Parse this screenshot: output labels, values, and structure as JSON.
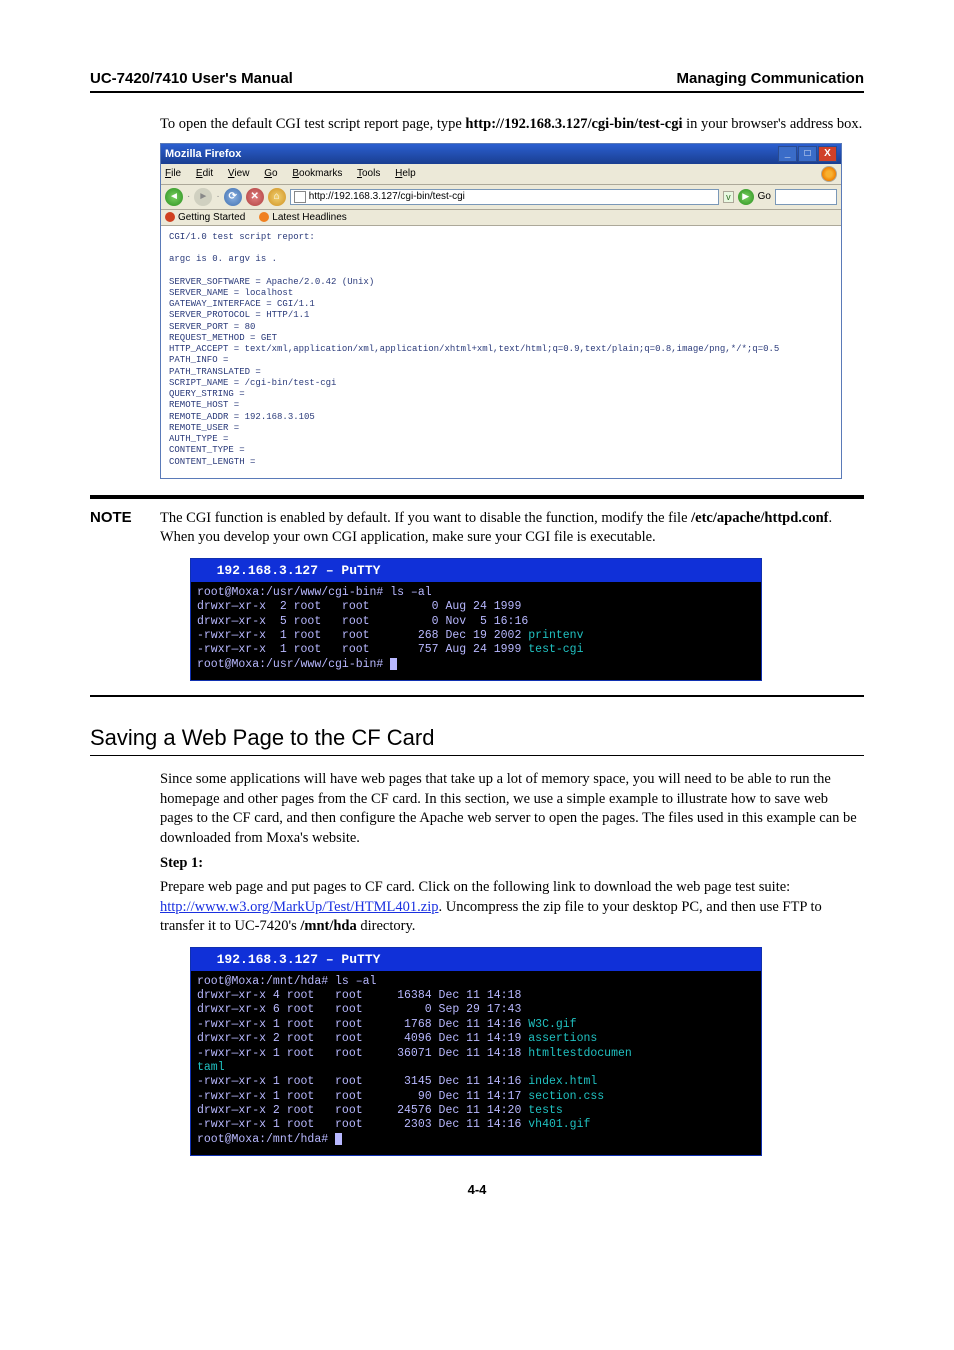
{
  "header": {
    "left": "UC-7420/7410 User's Manual",
    "right": "Managing Communication"
  },
  "intro": {
    "pre": "To open the default CGI test script report page, type ",
    "bold": "http://192.168.3.127/cgi-bin/test-cgi",
    "post": " in your browser's address box."
  },
  "firefox": {
    "title": "Mozilla Firefox",
    "menu": {
      "f": "File",
      "e": "Edit",
      "v": "View",
      "g": "Go",
      "b": "Bookmarks",
      "t": "Tools",
      "h": "Help"
    },
    "url": "http://192.168.3.127/cgi-bin/test-cgi",
    "go": "Go",
    "bookmarks": {
      "a": "Getting Started",
      "b": "Latest Headlines"
    },
    "content": "CGI/1.0 test script report:\n\nargc is 0. argv is .\n\nSERVER_SOFTWARE = Apache/2.0.42 (Unix)\nSERVER_NAME = localhost\nGATEWAY_INTERFACE = CGI/1.1\nSERVER_PROTOCOL = HTTP/1.1\nSERVER_PORT = 80\nREQUEST_METHOD = GET\nHTTP_ACCEPT = text/xml,application/xml,application/xhtml+xml,text/html;q=0.9,text/plain;q=0.8,image/png,*/*;q=0.5\nPATH_INFO =\nPATH_TRANSLATED =\nSCRIPT_NAME = /cgi-bin/test-cgi\nQUERY_STRING =\nREMOTE_HOST =\nREMOTE_ADDR = 192.168.3.105\nREMOTE_USER =\nAUTH_TYPE =\nCONTENT_TYPE =\nCONTENT_LENGTH ="
  },
  "note": {
    "label": "NOTE",
    "text_pre": "The CGI function is enabled by default. If you want to disable the function, modify the file ",
    "bold": "/etc/apache/httpd.conf",
    "text_post": ". When you develop your own CGI application, make sure your CGI file is executable."
  },
  "putty1": {
    "title": "192.168.3.127 – PuTTY",
    "l1": "root@Moxa:/usr/www/cgi-bin# ls –al",
    "l2a": "drwxr—xr-x  2 root   root         0 Aug 24 1999",
    "l3a": "drwxr—xr-x  5 root   root         0 Nov  5 16:16",
    "l4a": "-rwxr—xr-x  1 root   root       268 Dec 19 2002 ",
    "l4b": "printenv",
    "l5a": "-rwxr—xr-x  1 root   root       757 Aug 24 1999 ",
    "l5b": "test-cgi",
    "l6": "root@Moxa:/usr/www/cgi-bin#"
  },
  "section": {
    "heading": "Saving a Web Page to the CF Card",
    "para1": "Since some applications will have web pages that take up a lot of memory space, you will need to be able to run the homepage and other pages from the CF card. In this section, we use a simple example to illustrate how to save web pages to the CF card, and then configure the Apache web server to open the pages. The files used in this example can be downloaded from Moxa's website.",
    "step1_label": "Step 1:",
    "step1_a": "Prepare web page and put pages to CF card. Click on the following link to download the web page test suite: ",
    "step1_link": "http://www.w3.org/MarkUp/Test/HTML401.zip",
    "step1_b": ". Uncompress the zip file to your desktop PC, and then use FTP to transfer it to UC-7420's ",
    "step1_bold": "/mnt/hda",
    "step1_c": " directory."
  },
  "putty2": {
    "title": "192.168.3.127 – PuTTY",
    "l1": "root@Moxa:/mnt/hda# ls –al",
    "l2": "drwxr—xr-x 4 root   root     16384 Dec 11 14:18",
    "l3": "drwxr—xr-x 6 root   root         0 Sep 29 17:43",
    "l4a": "-rwxr—xr-x 1 root   root      1768 Dec 11 14:16 ",
    "l4b": "W3C.gif",
    "l5a": "drwxr—xr-x 2 root   root      4096 Dec 11 14:19 ",
    "l5b": "assertions",
    "l6a": "-rwxr—xr-x 1 root   root     36071 Dec 11 14:18 ",
    "l6b": "htmltestdocumen",
    "l6c": "taml",
    "l7a": "-rwxr—xr-x 1 root   root      3145 Dec 11 14:16 ",
    "l7b": "index.html",
    "l8a": "-rwxr—xr-x 1 root   root        90 Dec 11 14:17 ",
    "l8b": "section.css",
    "l9a": "drwxr—xr-x 2 root   root     24576 Dec 11 14:20 ",
    "l9b": "tests",
    "l10a": "-rwxr—xr-x 1 root   root      2303 Dec 11 14:16 ",
    "l10b": "vh401.gif",
    "l11": "root@Moxa:/mnt/hda#"
  },
  "page_number": "4-4"
}
